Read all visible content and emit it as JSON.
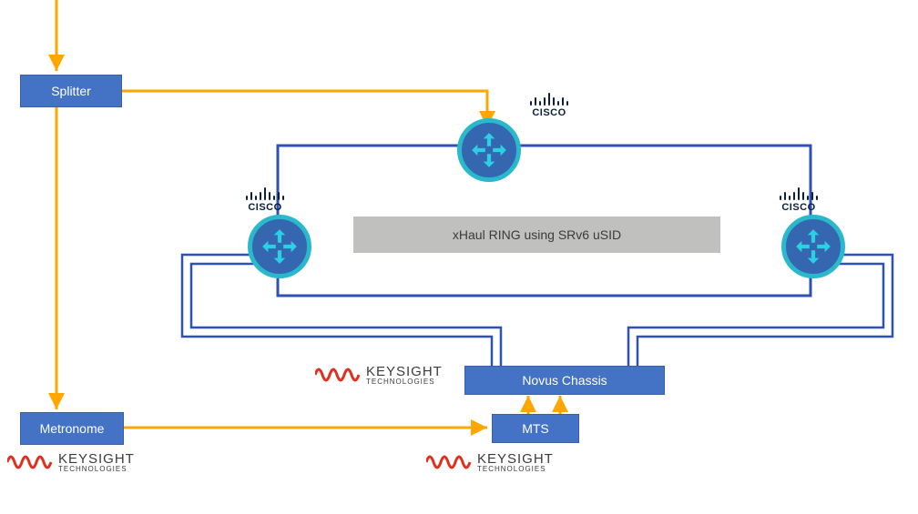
{
  "boxes": {
    "splitter": "Splitter",
    "metronome": "Metronome",
    "novus": "Novus Chassis",
    "mts": "MTS",
    "ring_label": "xHaul RING using SRv6 uSID"
  },
  "logos": {
    "cisco": "CISCO",
    "keysight_line1": "KEYSIGHT",
    "keysight_line2": "TECHNOLOGIES"
  },
  "colors": {
    "box_fill": "#4472c4",
    "arrow": "#ffa600",
    "ring_line": "#2f51b5",
    "router_border": "#29b8cc",
    "router_fill": "#3566b0",
    "label_fill": "#c0c0bf",
    "keysight_red": "#e0301e",
    "cisco_navy": "#0b213a"
  }
}
